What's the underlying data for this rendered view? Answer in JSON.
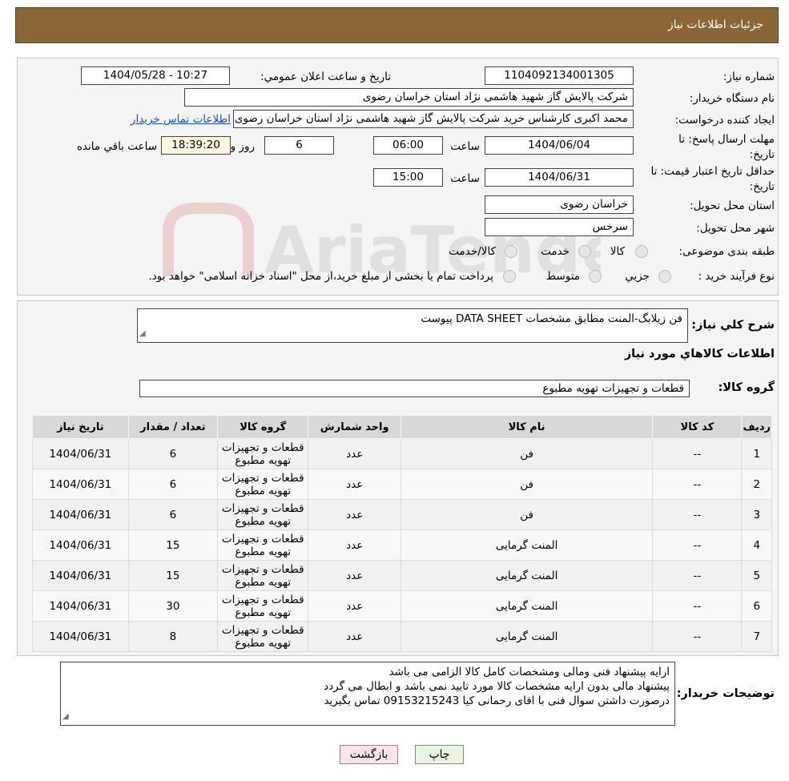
{
  "header": {
    "title": "جزئیات اطلاعات نیاز"
  },
  "form": {
    "need_number_label": "شماره نیاز:",
    "need_number": "1104092134001305",
    "announce_label": "تاریخ و ساعت اعلان عمومي:",
    "announce_value": "1404/05/28 - 10:27",
    "buyer_label": "نام دستگاه خریدار:",
    "buyer_value": "شرکت پالایش گاز شهید هاشمی نژاد   استان خراسان رضوی",
    "creator_label": "ایجاد کننده درخواست:",
    "creator_value": "محمد اکبری کارشناس خرید شرکت پالایش گاز شهید هاشمی نژاد   استان خراسان رضوی",
    "contact_link": "اطلاعات تماس خریدار",
    "deadline_label": "مهلت ارسال پاسخ: تا تاریخ:",
    "deadline_date": "1404/06/04",
    "time_label": "ساعت",
    "deadline_time": "06:00",
    "days_value": "6",
    "days_label": "روز و",
    "remaining_time": "18:39:20",
    "remaining_label": "ساعت باقي مانده",
    "validity_label": "حداقل تاریخ اعتبار قیمت: تا تاریخ:",
    "validity_date": "1404/06/31",
    "validity_time": "15:00",
    "province_label": "استان محل تحویل:",
    "province_value": "خراسان رضوی",
    "city_label": "شهر محل تحویل:",
    "city_value": "سرخس",
    "category_label": "طبقه بندی موضوعی:",
    "category_options": [
      "کالا",
      "خدمت",
      "کالا/خدمت"
    ],
    "process_label": "نوع فرآیند خرید :",
    "process_options": [
      "جزیي",
      "متوسط"
    ],
    "process_note": "پرداخت تمام یا بخشی از مبلغ خرید،از محل \"اسناد خزانه اسلامی\" خواهد بود."
  },
  "details": {
    "summary_label": "شرح کلي نیاز:",
    "summary_value": "فن زیلابگ-المنت مطابق مشخصات DATA SHEET پیوست",
    "items_title": "اطلاعات کالاهاي مورد نیاز",
    "group_label": "گروه کالا:",
    "group_value": "قطعات و تجهیزات تهویه مطبوع",
    "table": {
      "headers": [
        "ردیف",
        "کد کالا",
        "نام کالا",
        "واحد شمارش",
        "گروه کالا",
        "تعداد / مقدار",
        "تاریخ نیاز"
      ],
      "rows": [
        [
          "1",
          "--",
          "فن",
          "عدد",
          "قطعات و تجهیزات تهویه مطبوع",
          "6",
          "1404/06/31"
        ],
        [
          "2",
          "--",
          "فن",
          "عدد",
          "قطعات و تجهیزات تهویه مطبوع",
          "6",
          "1404/06/31"
        ],
        [
          "3",
          "--",
          "فن",
          "عدد",
          "قطعات و تجهیزات تهویه مطبوع",
          "6",
          "1404/06/31"
        ],
        [
          "4",
          "--",
          "المنت گرمایی",
          "عدد",
          "قطعات و تجهیزات تهویه مطبوع",
          "15",
          "1404/06/31"
        ],
        [
          "5",
          "--",
          "المنت گرمایی",
          "عدد",
          "قطعات و تجهیزات تهویه مطبوع",
          "15",
          "1404/06/31"
        ],
        [
          "6",
          "--",
          "المنت گرمایی",
          "عدد",
          "قطعات و تجهیزات تهویه مطبوع",
          "30",
          "1404/06/31"
        ],
        [
          "7",
          "--",
          "المنت گرمایی",
          "عدد",
          "قطعات و تجهیزات تهویه مطبوع",
          "8",
          "1404/06/31"
        ]
      ]
    },
    "buyer_notes_label": "توضیحات خریدار:",
    "buyer_notes": [
      "ارایه پیشنهاد فنی ومالی ومشخصات کامل کالا الزامی می باشد",
      "پیشنهاد مالی بدون ارایه مشخصات کالا مورد تایید نمی باشد و ابطال می گردد",
      "درصورت داشتن سوال فنی با اقای رحمانی کیا 09153215243 تماس بگیرید"
    ]
  },
  "buttons": {
    "print": "چاپ",
    "back": "بازگشت"
  },
  "watermark": {
    "text": "AriaTender.neT"
  },
  "colors": {
    "header_bg": "#8b6737",
    "link": "#1a4fd0",
    "back_button": "#fbe4e4",
    "print_button": "#e8f6e0"
  }
}
